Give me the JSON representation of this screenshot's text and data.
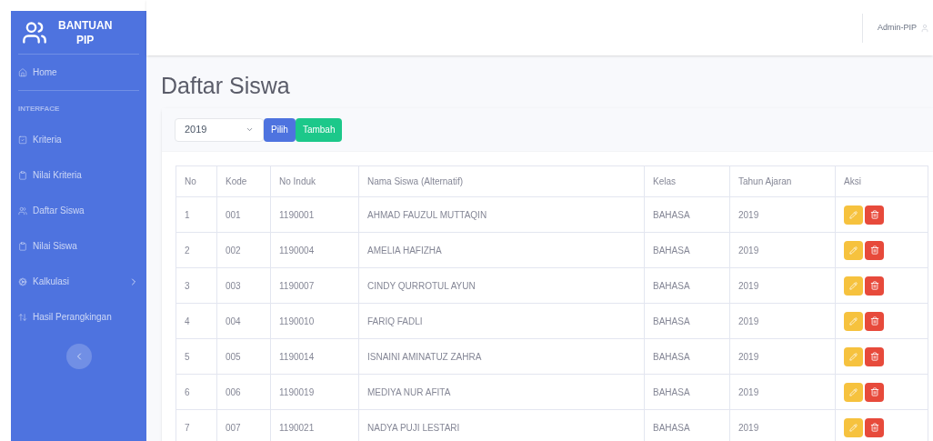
{
  "sidebar": {
    "brand": [
      "BANTUAN",
      "PIP"
    ],
    "items": [
      {
        "label": "Home",
        "kind": "link"
      },
      {
        "label": "INTERFACE",
        "kind": "heading"
      },
      {
        "label": "Kriteria",
        "kind": "link"
      },
      {
        "label": "Nilai Kriteria",
        "kind": "link"
      },
      {
        "label": "Daftar Siswa",
        "kind": "link"
      },
      {
        "label": "Nilai Siswa",
        "kind": "link"
      },
      {
        "label": "Kalkulasi",
        "kind": "submenu"
      },
      {
        "label": "Hasil Perangkingan",
        "kind": "link"
      }
    ]
  },
  "topbar": {
    "user": "Admin-PIP"
  },
  "page_title": "Daftar Siswa",
  "filter": {
    "year": "2019",
    "buttons": [
      "Pilih",
      "Tambah"
    ]
  },
  "table": {
    "columns": [
      "No",
      "Kode",
      "No Induk",
      "Nama Siswa (Alternatif)",
      "Kelas",
      "Tahun Ajaran",
      "Aksi"
    ],
    "rows": [
      [
        "1",
        "001",
        "1190001",
        "AHMAD FAUZUL MUTTAQIN",
        "BAHASA",
        "2019"
      ],
      [
        "2",
        "002",
        "1190004",
        "AMELIA HAFIZHA",
        "BAHASA",
        "2019"
      ],
      [
        "3",
        "003",
        "1190007",
        "CINDY QURROTUL AYUN",
        "BAHASA",
        "2019"
      ],
      [
        "4",
        "004",
        "1190010",
        "FARIQ FADLI",
        "BAHASA",
        "2019"
      ],
      [
        "5",
        "005",
        "1190014",
        "ISNAINI AMINATUZ ZAHRA",
        "BAHASA",
        "2019"
      ],
      [
        "6",
        "006",
        "1190019",
        "MEDIYA NUR AFITA",
        "BAHASA",
        "2019"
      ],
      [
        "7",
        "007",
        "1190021",
        "NADYA PUJI LESTARI",
        "BAHASA",
        "2019"
      ]
    ]
  }
}
